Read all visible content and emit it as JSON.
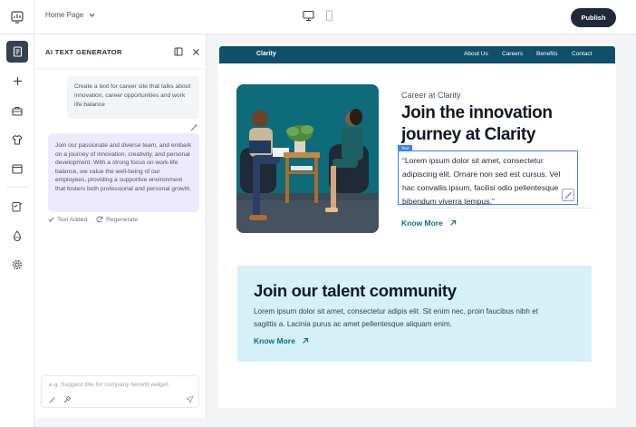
{
  "header": {
    "page_selector": "Home Page",
    "publish_label": "Publish"
  },
  "panel": {
    "title": "AI TEXT GENERATOR",
    "user_message": "Create a text for career site that talks about innovation, career opportunities and work life balance",
    "ai_message": "Join our passionate and diverse team, and embark on a journey of innovation, creativity, and personal development. With a strong focus on work-life balance, we value the well-being of our employees, providing a supportive environment that fosters both professional and personal growth.",
    "actions": {
      "text_added": "Text Added",
      "regenerate": "Regenerate"
    },
    "input_placeholder": "e.g. Suggest title for company benefit widget."
  },
  "site": {
    "brand": "Clarity",
    "nav": [
      "About Us",
      "Careers",
      "Benefits",
      "Contact"
    ],
    "hero": {
      "eyebrow": "Career at Clarity",
      "title": "Join the innovation journey at Clarity",
      "tag": "Text",
      "quote": "“Lorem ipsum dolor sit amet, consectetur adipiscing elit. Ornare non sed est cursus. Vel hac convallis ipsum, facilisi odio pellentesque bibendum viverra tempus.”",
      "cta": "Know More"
    },
    "talent": {
      "title": "Join our talent community",
      "body": "Lorem ipsum dolor sit amet, consectetur adipis elit. Sit enim nec, proin faucibus nibh et sagittis a. Lacinia purus ac amet pellentesque aliquam enim.",
      "cta": "Know More"
    }
  },
  "colors": {
    "nav_bg": "#0e4f6a",
    "accent": "#0e6b8a",
    "selection": "#3b82f6",
    "ai_bubble": "#ede9fe",
    "talent_bg": "#d5f0f7"
  }
}
